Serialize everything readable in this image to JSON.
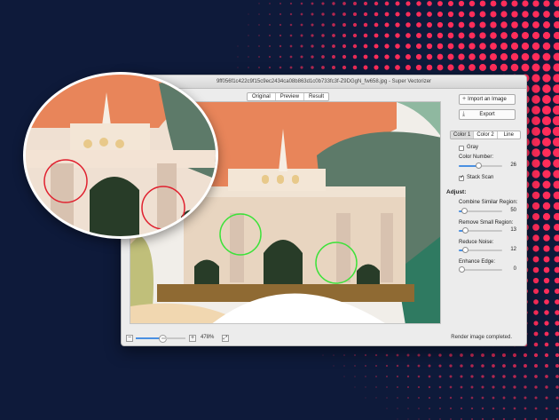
{
  "window": {
    "title": "9ff056f1c422c9f15c9ec2434ca08b863d1c0b733fc3f-Z9DGgN_fw658.jpg - Super Vectorizer"
  },
  "view_tabs": [
    "Original",
    "Preview",
    "Result"
  ],
  "sidebar": {
    "import_label": "Import an Image",
    "export_label": "Export",
    "tabs": [
      "Color 1",
      "Color 2",
      "Line"
    ],
    "gray_label": "Gray",
    "color_number_label": "Color Number:",
    "color_number_value": "26",
    "stack_scan_label": "Stack Scan",
    "adjust_heading": "Adjust:",
    "combine_label": "Combine Similar Region:",
    "combine_value": "50",
    "remove_label": "Remove Small Region:",
    "remove_value": "13",
    "noise_label": "Reduce Noise:",
    "noise_value": "12",
    "edge_label": "Enhance Edge:",
    "edge_value": "0"
  },
  "bottom": {
    "zoom_value": "478%",
    "status": "Render image completed."
  },
  "colors": {
    "background": "#0e1a3a",
    "dots": "#ff2d5a",
    "sky": "#e8855a",
    "highlight_green": "#3de23a",
    "highlight_red": "#e0202e"
  }
}
